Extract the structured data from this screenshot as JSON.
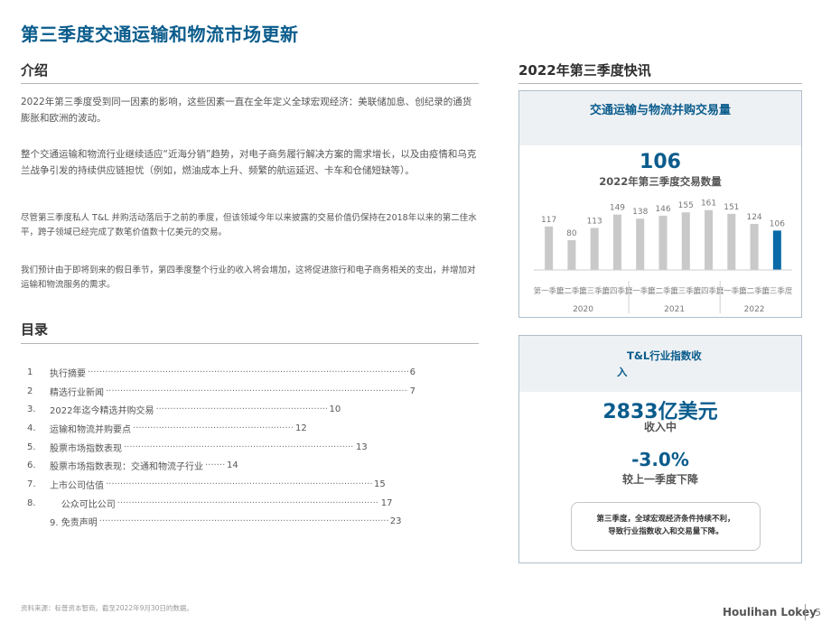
{
  "page_title": "第三季度交通运输和物流市场更新",
  "intro": {
    "heading": "介绍",
    "paragraphs": [
      "2022年第三季度受到同一因素的影响，这些因素一直在全年定义全球宏观经济：美联储加息、创纪录的通货膨胀和欧洲的波动。",
      "整个交通运输和物流行业继续适应“近海分销”趋势，对电子商务履行解决方案的需求增长，以及由疫情和乌克兰战争引发的持续供应链担忧（例如，燃油成本上升、频繁的航运延迟、卡车和仓储短缺等）。",
      "尽管第三季度私人 T&L 并购活动落后于之前的季度，但该领域今年以来披露的交易价值仍保持在2018年以来的第二佳水平，跨子领域已经完成了数笔价值数十亿美元的交易。",
      "我们预计由于即将到来的假日季节，第四季度整个行业的收入将会增加，这将促进旅行和电子商务相关的支出，并增加对运输和物流服务的需求。"
    ]
  },
  "toc": {
    "heading": "目录",
    "items": [
      {
        "num": "1",
        "text": "执行摘要",
        "page": "6"
      },
      {
        "num": "2",
        "text": "精选行业新闻",
        "page": "7"
      },
      {
        "num": "3.",
        "text": "2022年迄今精选并购交易",
        "page": "10"
      },
      {
        "num": "4.",
        "text": "运输和物流并购要点",
        "page": "12"
      },
      {
        "num": "5.",
        "text": "股票市场指数表现",
        "page": "13"
      },
      {
        "num": "6.",
        "text": "股票市场指数表现：交通和物流子行业",
        "page": "14"
      },
      {
        "num": "7.",
        "text": "上市公司估值",
        "page": "15"
      },
      {
        "num": "8.",
        "text": "    公众可比公司",
        "page": "17"
      },
      {
        "num": "",
        "text": "9. 免责声明",
        "page": "23"
      }
    ]
  },
  "flash": {
    "heading": "2022年第三季度快讯",
    "chart_title": "交通运输与物流并购交易量",
    "big_value": "106",
    "big_label": "2022年第三季度交易数量"
  },
  "index_panel": {
    "title_line1": "T&L行业指数收",
    "title_line2": "入",
    "revenue_value": "2833亿美元",
    "revenue_label": "收入中",
    "change_value": "-3.0%",
    "change_label": "较上一季度下降",
    "note_line1": "第三季度，全球宏观经济条件持续不利，",
    "note_line2": "导致行业指数收入和交易量下降。"
  },
  "footer": {
    "source": "资料来源：标普资本智商。截至2022年9月30日的数据。",
    "brand": "Houlihan Lokey",
    "page": "5"
  },
  "colors": {
    "brand_blue": "#0a5c8c",
    "bar_grey": "#c9c9c9",
    "bar_highlight": "#0a6aa8"
  },
  "chart_data": {
    "type": "bar",
    "title": "交通运输与物流并购交易量",
    "categories": [
      "第一季度",
      "第二季度",
      "第三季度",
      "第四季度",
      "第一季度",
      "第二季度",
      "第三季度",
      "第四季度",
      "第一季度",
      "第二季度",
      "第三季度"
    ],
    "values": [
      117,
      80,
      113,
      149,
      138,
      146,
      155,
      161,
      151,
      124,
      106
    ],
    "groups": [
      {
        "label": "2020",
        "count": 4
      },
      {
        "label": "2021",
        "count": 4
      },
      {
        "label": "2022",
        "count": 3
      }
    ],
    "highlight_index": 10,
    "ylim": [
      0,
      170
    ],
    "grid": false,
    "legend": "none"
  }
}
